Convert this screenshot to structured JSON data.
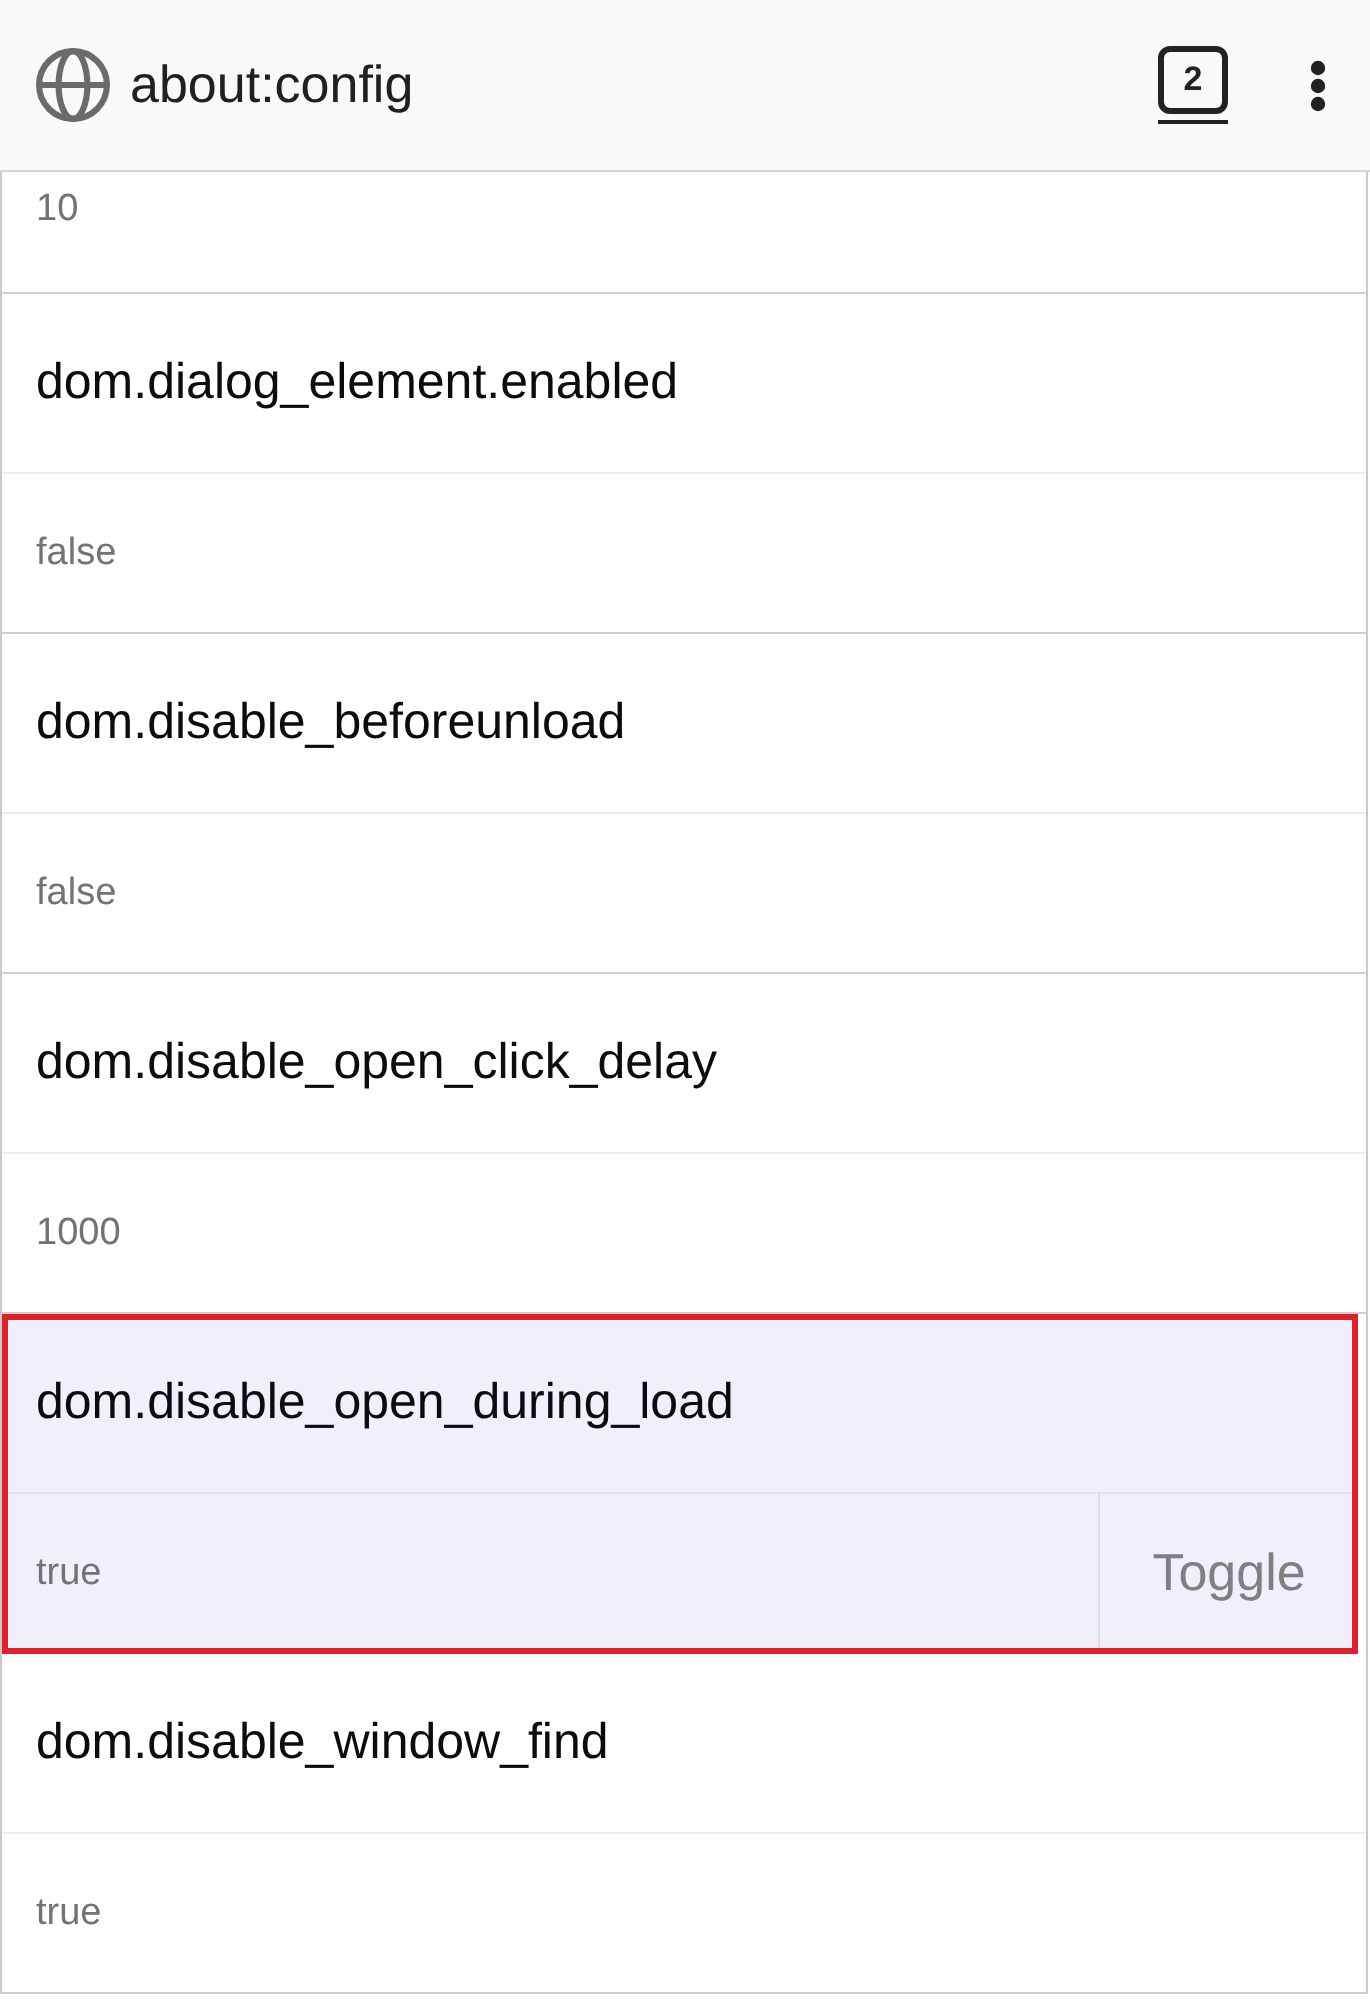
{
  "toolbar": {
    "url": "about:config",
    "tab_count": "2"
  },
  "prefs": [
    {
      "value": "10",
      "selected": false
    },
    {
      "name": "dom.dialog_element.enabled",
      "value": "false",
      "selected": false
    },
    {
      "name": "dom.disable_beforeunload",
      "value": "false",
      "selected": false
    },
    {
      "name": "dom.disable_open_click_delay",
      "value": "1000",
      "selected": false
    },
    {
      "name": "dom.disable_open_during_load",
      "value": "true",
      "selected": true,
      "action": "Toggle"
    },
    {
      "name": "dom.disable_window_find",
      "value": "true",
      "selected": false
    }
  ]
}
